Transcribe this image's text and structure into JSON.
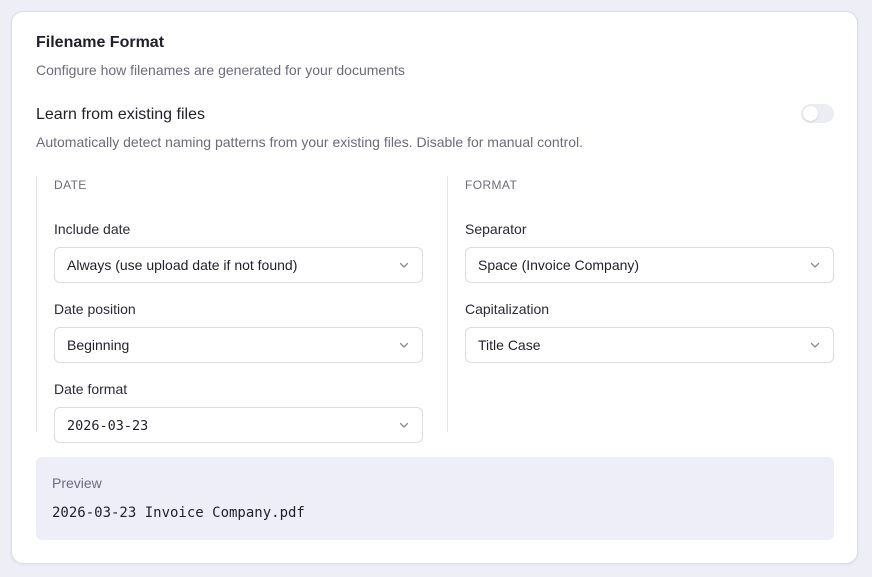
{
  "section": {
    "title": "Filename Format",
    "subtitle": "Configure how filenames are generated for your documents"
  },
  "learn": {
    "label": "Learn from existing files",
    "description": "Automatically detect naming patterns from your existing files. Disable for manual control.",
    "enabled": false
  },
  "date_group": {
    "heading": "DATE",
    "include_date": {
      "label": "Include date",
      "value": "Always (use upload date if not found)"
    },
    "date_position": {
      "label": "Date position",
      "value": "Beginning"
    },
    "date_format": {
      "label": "Date format",
      "value": "2026-03-23"
    }
  },
  "format_group": {
    "heading": "FORMAT",
    "separator": {
      "label": "Separator",
      "value": "Space (Invoice Company)"
    },
    "capitalization": {
      "label": "Capitalization",
      "value": "Title Case"
    }
  },
  "preview": {
    "label": "Preview",
    "value": "2026-03-23 Invoice Company.pdf"
  },
  "colors": {
    "card_bg": "#ffffff",
    "page_bg": "#eeeef6",
    "preview_bg": "#eeeef8",
    "muted_text": "#6b6b80",
    "toggle_off": "#ececf4"
  },
  "icons": {
    "select_chevron": "chevron-down-icon"
  }
}
